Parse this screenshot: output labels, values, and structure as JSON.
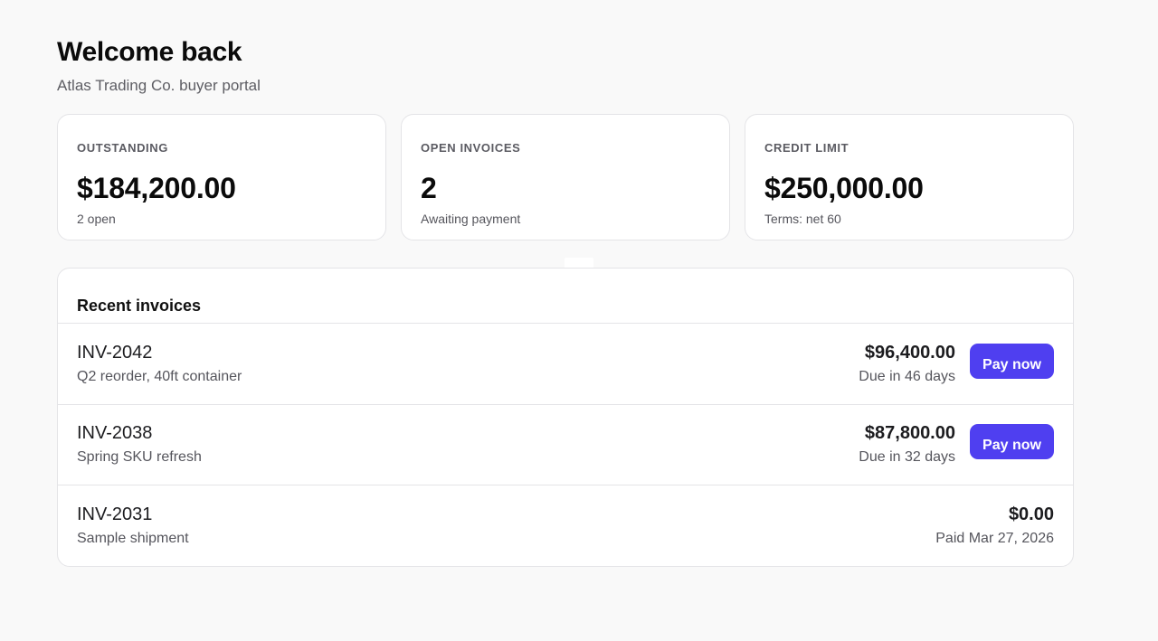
{
  "header": {
    "title": "Welcome back",
    "subtitle": "Atlas Trading Co. buyer portal"
  },
  "stats": [
    {
      "label": "OUTSTANDING",
      "value": "$184,200.00",
      "sub": "2 open"
    },
    {
      "label": "OPEN INVOICES",
      "value": "2",
      "sub": "Awaiting payment"
    },
    {
      "label": "CREDIT LIMIT",
      "value": "$250,000.00",
      "sub": "Terms: net 60"
    }
  ],
  "invoices": {
    "title": "Recent invoices",
    "rows": [
      {
        "id": "INV-2042",
        "description": "Q2 reorder, 40ft container",
        "amount": "$96,400.00",
        "status": "Due in 46 days",
        "action": "Pay now"
      },
      {
        "id": "INV-2038",
        "description": "Spring SKU refresh",
        "amount": "$87,800.00",
        "status": "Due in 32 days",
        "action": "Pay now"
      },
      {
        "id": "INV-2031",
        "description": "Sample shipment",
        "amount": "$0.00",
        "status": "Paid Mar 27, 2026"
      }
    ]
  },
  "colors": {
    "accent": "#4f3ff0",
    "background": "#f9f9f9",
    "card": "#ffffff",
    "border": "#e4e4e7"
  }
}
